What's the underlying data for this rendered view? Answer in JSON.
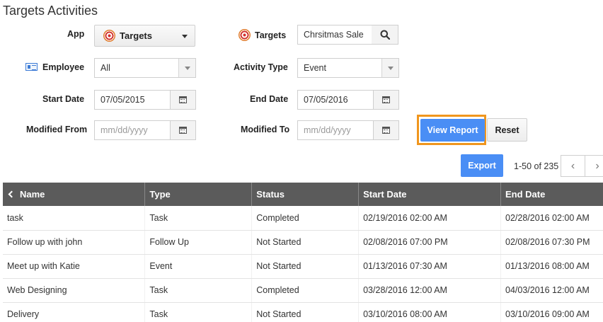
{
  "page": {
    "title": "Targets Activities"
  },
  "filters": {
    "app": {
      "label": "App",
      "value": "Targets"
    },
    "targets": {
      "label": "Targets",
      "value": "Chrsitmas Sale"
    },
    "employee": {
      "label": "Employee",
      "value": "All"
    },
    "activity_type": {
      "label": "Activity Type",
      "value": "Event"
    },
    "start_date": {
      "label": "Start Date",
      "value": "07/05/2015"
    },
    "end_date": {
      "label": "End Date",
      "value": "07/05/2016"
    },
    "modified_from": {
      "label": "Modified From",
      "placeholder": "mm/dd/yyyy"
    },
    "modified_to": {
      "label": "Modified To",
      "placeholder": "mm/dd/yyyy"
    }
  },
  "actions": {
    "view_report": "View Report",
    "reset": "Reset",
    "export": "Export"
  },
  "pager": {
    "info": "1-50 of 235",
    "prev": "‹",
    "next": "›"
  },
  "table": {
    "columns": [
      "Name",
      "Type",
      "Status",
      "Start Date",
      "End Date"
    ],
    "rows": [
      [
        "task",
        "Task",
        "Completed",
        "02/19/2016 02:00 AM",
        "02/28/2016 02:00 AM"
      ],
      [
        "Follow up with john",
        "Follow Up",
        "Not Started",
        "02/08/2016 07:00 PM",
        "02/08/2016 07:30 PM"
      ],
      [
        "Meet up with Katie",
        "Event",
        "Not Started",
        "01/13/2016 07:30 AM",
        "01/13/2016 08:00 AM"
      ],
      [
        "Web Designing",
        "Task",
        "Completed",
        "03/28/2016 12:00 AM",
        "04/03/2016 12:00 AM"
      ],
      [
        "Delivery",
        "Task",
        "Not Started",
        "03/10/2016 08:00 AM",
        "03/10/2016 09:00 AM"
      ]
    ]
  },
  "colors": {
    "primary": "#4a8ef5",
    "highlight": "#f0961e",
    "header_bg": "#5b5b5b"
  }
}
